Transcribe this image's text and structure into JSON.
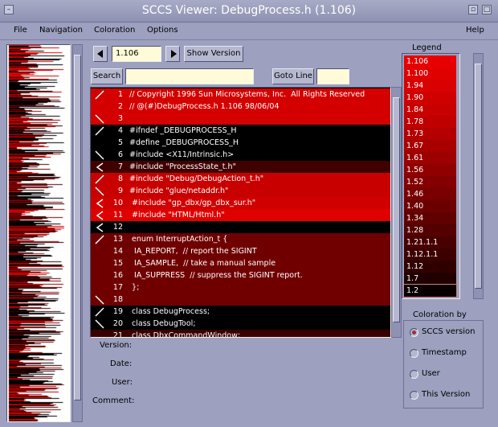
{
  "window": {
    "title": "SCCS Viewer: DebugProcess.h (1.106)"
  },
  "menu": {
    "file": "File",
    "navigation": "Navigation",
    "coloration": "Coloration",
    "options": "Options",
    "help": "Help"
  },
  "toolbar": {
    "version_value": "1.106",
    "show_version": "Show Version",
    "search_label": "Search",
    "search_value": "",
    "goto_label": "Goto Line",
    "goto_value": ""
  },
  "code": [
    {
      "num": "1",
      "text": "// Copyright 1996 Sun Microsystems, Inc.  All Rights Reserved",
      "color": "#d40000",
      "mark": "/"
    },
    {
      "num": "2",
      "text": "// @(#)DebugProcess.h 1.106 98/06/04",
      "color": "#d40000",
      "mark": ""
    },
    {
      "num": "3",
      "text": "",
      "color": "#d40000",
      "mark": "\\"
    },
    {
      "num": "4",
      "text": "#ifndef _DEBUGPROCESS_H",
      "color": "#000000",
      "mark": "/"
    },
    {
      "num": "5",
      "text": "#define _DEBUGPROCESS_H",
      "color": "#000000",
      "mark": ""
    },
    {
      "num": "6",
      "text": "#include <X11/Intrinsic.h>",
      "color": "#000000",
      "mark": "\\"
    },
    {
      "num": "7",
      "text": "#include \"ProcessState_t.h\"",
      "color": "#400000",
      "mark": "<"
    },
    {
      "num": "8",
      "text": "#include \"Debug/DebugAction_t.h\"",
      "color": "#c80000",
      "mark": "/"
    },
    {
      "num": "9",
      "text": "#include \"glue/netaddr.h\"",
      "color": "#c80000",
      "mark": "\\"
    },
    {
      "num": "10",
      "text": " #include \"gp_dbx/gp_dbx_sur.h\"",
      "color": "#d00000",
      "mark": "<"
    },
    {
      "num": "11",
      "text": " #include \"HTML/Html.h\"",
      "color": "#e00000",
      "mark": "<"
    },
    {
      "num": "12",
      "text": "",
      "color": "#000000",
      "mark": "<"
    },
    {
      "num": "13",
      "text": " enum InterruptAction_t {",
      "color": "#700000",
      "mark": "/"
    },
    {
      "num": "14",
      "text": "  IA_REPORT,  // report the SIGINT",
      "color": "#700000",
      "mark": ""
    },
    {
      "num": "15",
      "text": "  IA_SAMPLE,  // take a manual sample",
      "color": "#700000",
      "mark": ""
    },
    {
      "num": "16",
      "text": "  IA_SUPPRESS  // suppress the SIGINT report.",
      "color": "#700000",
      "mark": ""
    },
    {
      "num": "17",
      "text": " };",
      "color": "#700000",
      "mark": ""
    },
    {
      "num": "18",
      "text": "",
      "color": "#700000",
      "mark": "\\"
    },
    {
      "num": "19",
      "text": " class DebugProcess;",
      "color": "#000000",
      "mark": "/"
    },
    {
      "num": "20",
      "text": " class DebugTool;",
      "color": "#000000",
      "mark": "\\"
    },
    {
      "num": "21",
      "text": " class DbxCommandWindow;",
      "color": "#3a0000",
      "mark": ""
    }
  ],
  "info": {
    "version": "Version:",
    "date": "Date:",
    "user": "User:",
    "comment": "Comment:"
  },
  "legend": {
    "title": "Legend",
    "items": [
      {
        "label": "1.106",
        "color": "#e80000"
      },
      {
        "label": "1.100",
        "color": "#e00000"
      },
      {
        "label": "1.94",
        "color": "#d80000"
      },
      {
        "label": "1.90",
        "color": "#d00000"
      },
      {
        "label": "1.84",
        "color": "#c80000"
      },
      {
        "label": "1.78",
        "color": "#c00000"
      },
      {
        "label": "1.73",
        "color": "#b40000"
      },
      {
        "label": "1.67",
        "color": "#a80000"
      },
      {
        "label": "1.61",
        "color": "#9c0000"
      },
      {
        "label": "1.56",
        "color": "#900000"
      },
      {
        "label": "1.52",
        "color": "#840000"
      },
      {
        "label": "1.46",
        "color": "#780000"
      },
      {
        "label": "1.40",
        "color": "#6c0000"
      },
      {
        "label": "1.34",
        "color": "#600000"
      },
      {
        "label": "1.28",
        "color": "#540000"
      },
      {
        "label": "1.21.1.1",
        "color": "#480000"
      },
      {
        "label": "1.12.1.1",
        "color": "#3c0000"
      },
      {
        "label": "1.12",
        "color": "#300000"
      },
      {
        "label": "1.7",
        "color": "#200000"
      },
      {
        "label": "1.2",
        "color": "#080000"
      }
    ]
  },
  "coloration": {
    "title": "Coloration by",
    "options": [
      {
        "label": "SCCS version",
        "selected": true
      },
      {
        "label": "Timestamp",
        "selected": false
      },
      {
        "label": "User",
        "selected": false
      },
      {
        "label": "This Version",
        "selected": false
      }
    ]
  }
}
